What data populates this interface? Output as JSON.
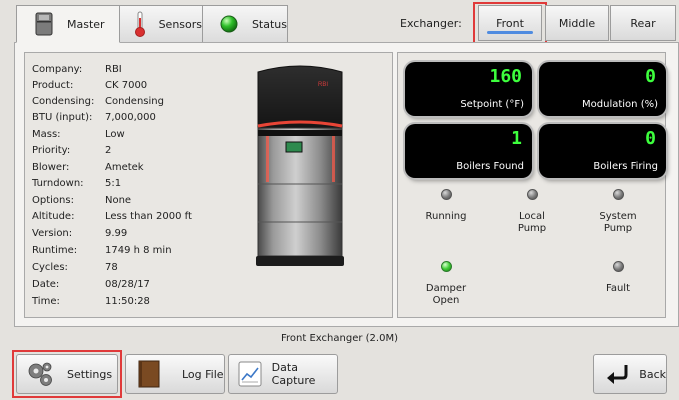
{
  "tabs": [
    {
      "label": "Master",
      "icon": "boiler-icon",
      "active": true
    },
    {
      "label": "Sensors",
      "icon": "thermometer-icon",
      "active": false
    },
    {
      "label": "Status",
      "icon": "green-status-icon",
      "active": false
    }
  ],
  "exchanger": {
    "label": "Exchanger:",
    "buttons": [
      {
        "label": "Front",
        "selected": true
      },
      {
        "label": "Middle",
        "selected": false
      },
      {
        "label": "Rear",
        "selected": false
      }
    ]
  },
  "info": [
    {
      "label": "Company:",
      "value": "RBI"
    },
    {
      "label": "Product:",
      "value": "CK 7000"
    },
    {
      "label": "Condensing:",
      "value": "Condensing"
    },
    {
      "label": "BTU (input):",
      "value": "7,000,000"
    },
    {
      "label": "Mass:",
      "value": "Low"
    },
    {
      "label": "Priority:",
      "value": "2"
    },
    {
      "label": "Blower:",
      "value": "Ametek"
    },
    {
      "label": "Turndown:",
      "value": "5:1"
    },
    {
      "label": "Options:",
      "value": "None"
    },
    {
      "label": "Altitude:",
      "value": "Less than 2000 ft"
    },
    {
      "label": "Version:",
      "value": "9.99"
    },
    {
      "label": "Runtime:",
      "value": "1749 h 8 min"
    },
    {
      "label": "Cycles:",
      "value": "78"
    },
    {
      "label": "Date:",
      "value": "08/28/17"
    },
    {
      "label": "Time:",
      "value": "11:50:28"
    }
  ],
  "boiler_brand": "RBI",
  "readouts": [
    {
      "value": "160",
      "caption": "Setpoint (°F)"
    },
    {
      "value": "0",
      "caption": "Modulation (%)"
    },
    {
      "value": "1",
      "caption": "Boilers Found"
    },
    {
      "value": "0",
      "caption": "Boilers Firing"
    }
  ],
  "indicators": [
    {
      "label": "Running",
      "on": false
    },
    {
      "label": "Local\nPump",
      "on": false
    },
    {
      "label": "System\nPump",
      "on": false
    },
    {
      "label": "Damper\nOpen",
      "on": true
    },
    {
      "label": "Fault",
      "on": false
    }
  ],
  "status_line": "Front Exchanger (2.0M)",
  "bottom_buttons": {
    "settings": "Settings",
    "log_file": "Log File",
    "data_capture": "Data Capture",
    "back": "Back"
  },
  "colors": {
    "readout_value": "#3dff3d",
    "highlight_outline": "#e03a3a",
    "selected_underline": "#4f8be0",
    "led_on": "#3fcc35"
  }
}
